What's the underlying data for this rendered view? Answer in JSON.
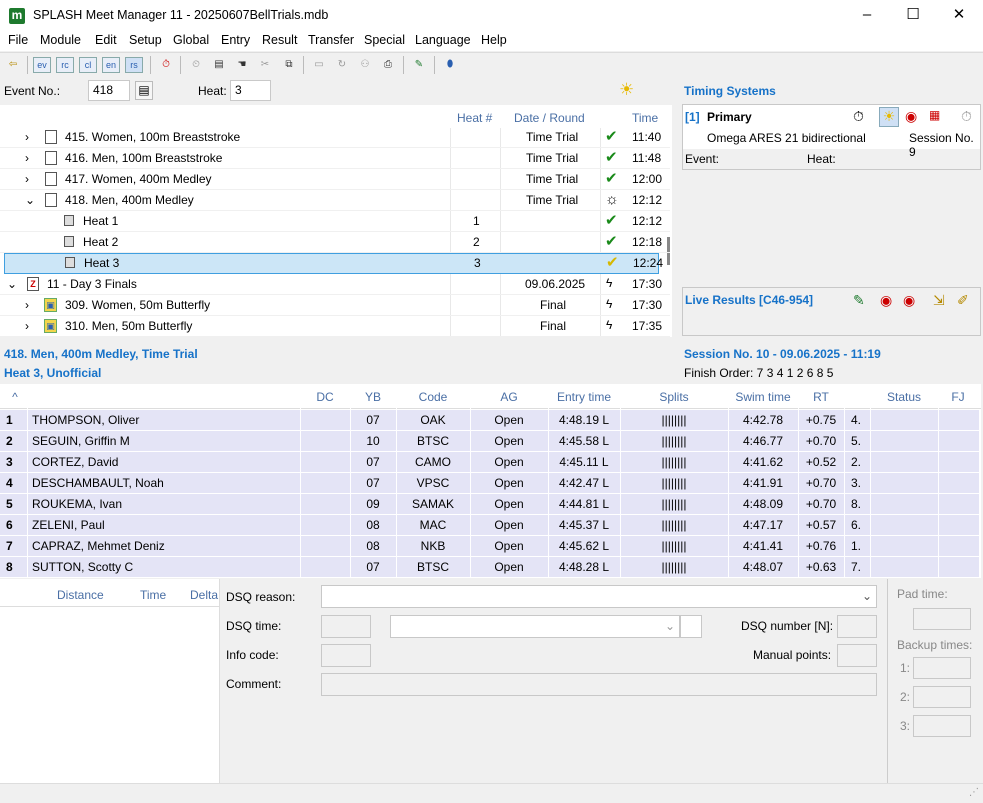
{
  "window": {
    "title": "SPLASH Meet Manager 11 - 20250607BellTrials.mdb",
    "minimize": "–",
    "maximize": "☐",
    "close": "✕"
  },
  "menu": [
    "File",
    "Module",
    "Edit",
    "Setup",
    "Global",
    "Entry",
    "Result",
    "Transfer",
    "Special",
    "Language",
    "Help"
  ],
  "toolbar": {
    "lang_buttons": [
      "ev",
      "rc",
      "cl",
      "en",
      "rs"
    ]
  },
  "event_bar": {
    "event_label": "Event No.:",
    "event_value": "418",
    "heat_label": "Heat:",
    "heat_value": "3"
  },
  "tree": {
    "headers": {
      "heat": "Heat #",
      "date": "Date / Round",
      "time": "Time"
    },
    "rows": [
      {
        "label": "415. Women, 100m Breaststroke",
        "heat": "",
        "date": "Time Trial",
        "status": "check",
        "time": "11:40"
      },
      {
        "label": "416. Men, 100m Breaststroke",
        "heat": "",
        "date": "Time Trial",
        "status": "check",
        "time": "11:48"
      },
      {
        "label": "417. Women, 400m Medley",
        "heat": "",
        "date": "Time Trial",
        "status": "check",
        "time": "12:00"
      },
      {
        "label": "418. Men, 400m Medley",
        "heat": "",
        "date": "Time Trial",
        "status": "sun",
        "time": "12:12"
      },
      {
        "label": "Heat 1",
        "heat": "1",
        "date": "",
        "status": "check",
        "time": "12:12"
      },
      {
        "label": "Heat 2",
        "heat": "2",
        "date": "",
        "status": "check",
        "time": "12:18"
      },
      {
        "label": "Heat 3",
        "heat": "3",
        "date": "",
        "status": "check-yellow",
        "time": "12:24"
      },
      {
        "label": "11 - Day 3 Finals",
        "heat": "",
        "date": "09.06.2025",
        "status": "lightning",
        "time": "17:30"
      },
      {
        "label": "309. Women, 50m Butterfly",
        "heat": "",
        "date": "Final",
        "status": "lightning",
        "time": "17:30"
      },
      {
        "label": "310. Men, 50m Butterfly",
        "heat": "",
        "date": "Final",
        "status": "lightning",
        "time": "17:35"
      }
    ]
  },
  "timing": {
    "title": "Timing Systems",
    "index": "[1]",
    "name": "Primary",
    "device": "Omega ARES 21 bidirectional",
    "session": "Session No. 9",
    "event_label": "Event:",
    "heat_label": "Heat:"
  },
  "live": {
    "title": "Live Results [C46-954]"
  },
  "strip": {
    "event_title": "418. Men, 400m Medley, Time Trial",
    "heat_title": "Heat 3, Unofficial",
    "session": "Session  No. 10 - 09.06.2025 - 11:19",
    "finish_order": "Finish Order: 7 3 4 1 2 6 8 5"
  },
  "grid": {
    "headers": {
      "sort": "^",
      "dc": "DC",
      "yb": "YB",
      "code": "Code",
      "ag": "AG",
      "entry": "Entry time",
      "splits": "Splits",
      "swim": "Swim time",
      "rt": "RT",
      "status": "Status",
      "fj": "FJ"
    },
    "rows": [
      {
        "lane": "1",
        "name": "THOMPSON, Oliver",
        "yb": "07",
        "code": "OAK",
        "ag": "Open",
        "entry": "4:48.19 L",
        "splits": "||||||||",
        "swim": "4:42.78",
        "rt": "+0.75",
        "place": "4."
      },
      {
        "lane": "2",
        "name": "SEGUIN, Griffin M",
        "yb": "10",
        "code": "BTSC",
        "ag": "Open",
        "entry": "4:45.58 L",
        "splits": "||||||||",
        "swim": "4:46.77",
        "rt": "+0.70",
        "place": "5."
      },
      {
        "lane": "3",
        "name": "CORTEZ, David",
        "yb": "07",
        "code": "CAMO",
        "ag": "Open",
        "entry": "4:45.11 L",
        "splits": "||||||||",
        "swim": "4:41.62",
        "rt": "+0.52",
        "place": "2."
      },
      {
        "lane": "4",
        "name": "DESCHAMBAULT, Noah",
        "yb": "07",
        "code": "VPSC",
        "ag": "Open",
        "entry": "4:42.47 L",
        "splits": "||||||||",
        "swim": "4:41.91",
        "rt": "+0.70",
        "place": "3."
      },
      {
        "lane": "5",
        "name": "ROUKEMA, Ivan",
        "yb": "09",
        "code": "SAMAK",
        "ag": "Open",
        "entry": "4:44.81 L",
        "splits": "||||||||",
        "swim": "4:48.09",
        "rt": "+0.70",
        "place": "8."
      },
      {
        "lane": "6",
        "name": "ZELENI, Paul",
        "yb": "08",
        "code": "MAC",
        "ag": "Open",
        "entry": "4:45.37 L",
        "splits": "||||||||",
        "swim": "4:47.17",
        "rt": "+0.57",
        "place": "6."
      },
      {
        "lane": "7",
        "name": "CAPRAZ, Mehmet Deniz",
        "yb": "08",
        "code": "NKB",
        "ag": "Open",
        "entry": "4:45.62 L",
        "splits": "||||||||",
        "swim": "4:41.41",
        "rt": "+0.76",
        "place": "1."
      },
      {
        "lane": "8",
        "name": "SUTTON, Scotty C",
        "yb": "07",
        "code": "BTSC",
        "ag": "Open",
        "entry": "4:48.28 L",
        "splits": "||||||||",
        "swim": "4:48.07",
        "rt": "+0.63",
        "place": "7."
      }
    ]
  },
  "bottom": {
    "distance": "Distance",
    "time": "Time",
    "delta": "Delta",
    "dsq_reason": "DSQ reason:",
    "dsq_time": "DSQ time:",
    "dsq_number": "DSQ number [N]:",
    "info_code": "Info code:",
    "manual_points": "Manual points:",
    "comment": "Comment:",
    "pad_time": "Pad time:",
    "backup_times": "Backup times:",
    "b1": "1:",
    "b2": "2:",
    "b3": "3:"
  }
}
